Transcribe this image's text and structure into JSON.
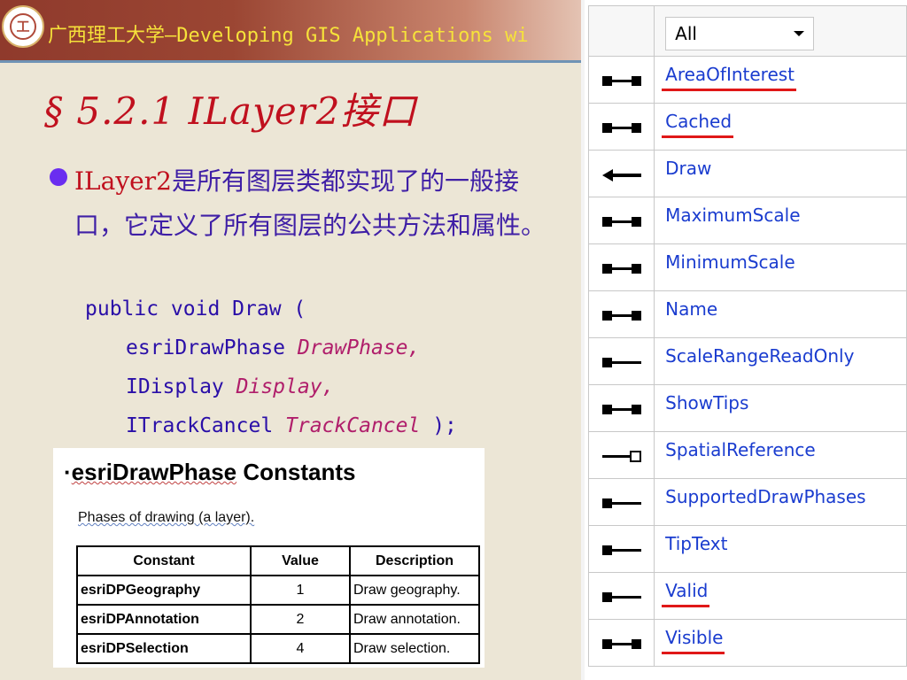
{
  "header": {
    "logo_glyph": "工",
    "title": "广西理工大学—Developing GIS Applications wi"
  },
  "slide": {
    "title": "§  5.2.1   ILayer2接口",
    "bullet_highlight": "ILayer2",
    "bullet_text": "是所有图层类都实现了的一般接口，它定义了所有图层的公共方法和属性。",
    "code": {
      "line1": "public void Draw (",
      "line2_type": "esriDrawPhase ",
      "line2_param": "DrawPhase,",
      "line3_type": "IDisplay ",
      "line3_param": "Display,",
      "line4_type": "ITrackCancel ",
      "line4_param": "TrackCancel",
      "line4_end": " );"
    }
  },
  "doc": {
    "title_bullet": "·",
    "title_a": "esriDrawPhase",
    "title_b": "Constants",
    "subtitle": "Phases of drawing (a layer).",
    "columns": [
      "Constant",
      "Value",
      "Description"
    ],
    "rows": [
      {
        "constant": "esriDPGeography",
        "value": "1",
        "description": "Draw geography."
      },
      {
        "constant": "esriDPAnnotation",
        "value": "2",
        "description": "Draw annotation."
      },
      {
        "constant": "esriDPSelection",
        "value": "4",
        "description": "Draw selection."
      }
    ]
  },
  "members": {
    "filter_value": "All",
    "items": [
      {
        "name": "AreaOfInterest",
        "icon": "read-write-property-icon",
        "underlined": true
      },
      {
        "name": "Cached",
        "icon": "read-write-property-icon",
        "underlined": true
      },
      {
        "name": "Draw",
        "icon": "method-icon",
        "underlined": false
      },
      {
        "name": "MaximumScale",
        "icon": "read-write-property-icon",
        "underlined": false
      },
      {
        "name": "MinimumScale",
        "icon": "read-write-property-icon",
        "underlined": false
      },
      {
        "name": "Name",
        "icon": "read-write-property-icon",
        "underlined": false
      },
      {
        "name": "ScaleRangeReadOnly",
        "icon": "read-only-property-icon",
        "underlined": false
      },
      {
        "name": "ShowTips",
        "icon": "read-write-property-icon",
        "underlined": false
      },
      {
        "name": "SpatialReference",
        "icon": "write-only-property-icon",
        "underlined": false
      },
      {
        "name": "SupportedDrawPhases",
        "icon": "read-only-property-icon",
        "underlined": false
      },
      {
        "name": "TipText",
        "icon": "read-only-property-icon",
        "underlined": false
      },
      {
        "name": "Valid",
        "icon": "read-only-property-icon",
        "underlined": true
      },
      {
        "name": "Visible",
        "icon": "read-write-property-icon",
        "underlined": true
      }
    ]
  },
  "colors": {
    "title_red": "#c0101e",
    "text_purple": "#3f1fa6",
    "link_blue": "#1a3ccf",
    "underline_red": "#e01818"
  }
}
